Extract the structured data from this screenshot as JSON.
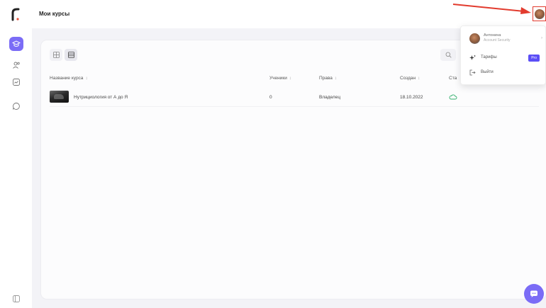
{
  "header": {
    "title": "Мои курсы"
  },
  "sidebar": {
    "items": [
      {
        "icon": "graduation-cap-icon",
        "active": true
      },
      {
        "icon": "users-icon",
        "active": false
      },
      {
        "icon": "chart-icon",
        "active": false
      },
      {
        "icon": "chat-icon",
        "active": false
      },
      {
        "icon": "collapse-icon",
        "active": false
      }
    ],
    "accent": "#7b6cf6"
  },
  "toolbar": {
    "grid_view_icon": "grid-icon",
    "list_view_icon": "list-icon",
    "search_icon": "search-icon"
  },
  "table": {
    "columns": [
      "Название курса",
      "Ученики",
      "Права",
      "Создан",
      "Ста"
    ],
    "rows": [
      {
        "name": "Нутрициология от А до Я",
        "students": "0",
        "rights": "Владелец",
        "created": "18.10.2022",
        "status_icon": "cloud-icon"
      }
    ]
  },
  "user_menu": {
    "name": "Антонина",
    "role": "Account Security",
    "items": [
      {
        "label": "Тарифы",
        "icon": "sparkle-icon",
        "badge": "Pro"
      },
      {
        "label": "Выйти",
        "icon": "logout-icon"
      }
    ]
  },
  "colors": {
    "accent": "#7b6cf6",
    "badge": "#5b4ef6",
    "highlight": "#e23b2e"
  }
}
